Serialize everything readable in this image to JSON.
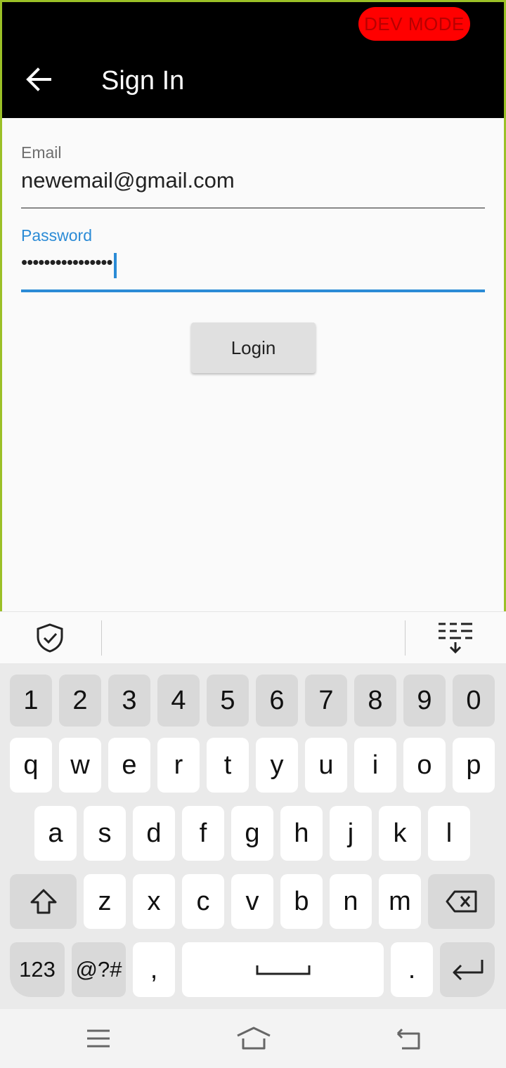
{
  "app_bar": {
    "title": "Sign In",
    "dev_badge": "DEV MODE",
    "back_icon": "arrow-back-icon"
  },
  "form": {
    "email": {
      "label": "Email",
      "value": "newemail@gmail.com"
    },
    "password": {
      "label": "Password",
      "value": "••••••••••••••••"
    },
    "login_label": "Login"
  },
  "keyboard": {
    "numbers": [
      "1",
      "2",
      "3",
      "4",
      "5",
      "6",
      "7",
      "8",
      "9",
      "0"
    ],
    "row1": [
      "q",
      "w",
      "e",
      "r",
      "t",
      "y",
      "u",
      "i",
      "o",
      "p"
    ],
    "row2": [
      "a",
      "s",
      "d",
      "f",
      "g",
      "h",
      "j",
      "k",
      "l"
    ],
    "row3": [
      "z",
      "x",
      "c",
      "v",
      "b",
      "n",
      "m"
    ],
    "bottom": {
      "sym123": "123",
      "symbols": "@?#",
      "comma": ",",
      "period": "."
    },
    "icons": [
      "shield-check-icon",
      "keyboard-hide-icon",
      "shift-icon",
      "backspace-icon",
      "enter-icon",
      "space-icon"
    ]
  },
  "colors": {
    "accent": "#2b8bd6",
    "appbar": "#000000",
    "dev_badge_bg": "#ff0000",
    "border": "#9bc027"
  }
}
